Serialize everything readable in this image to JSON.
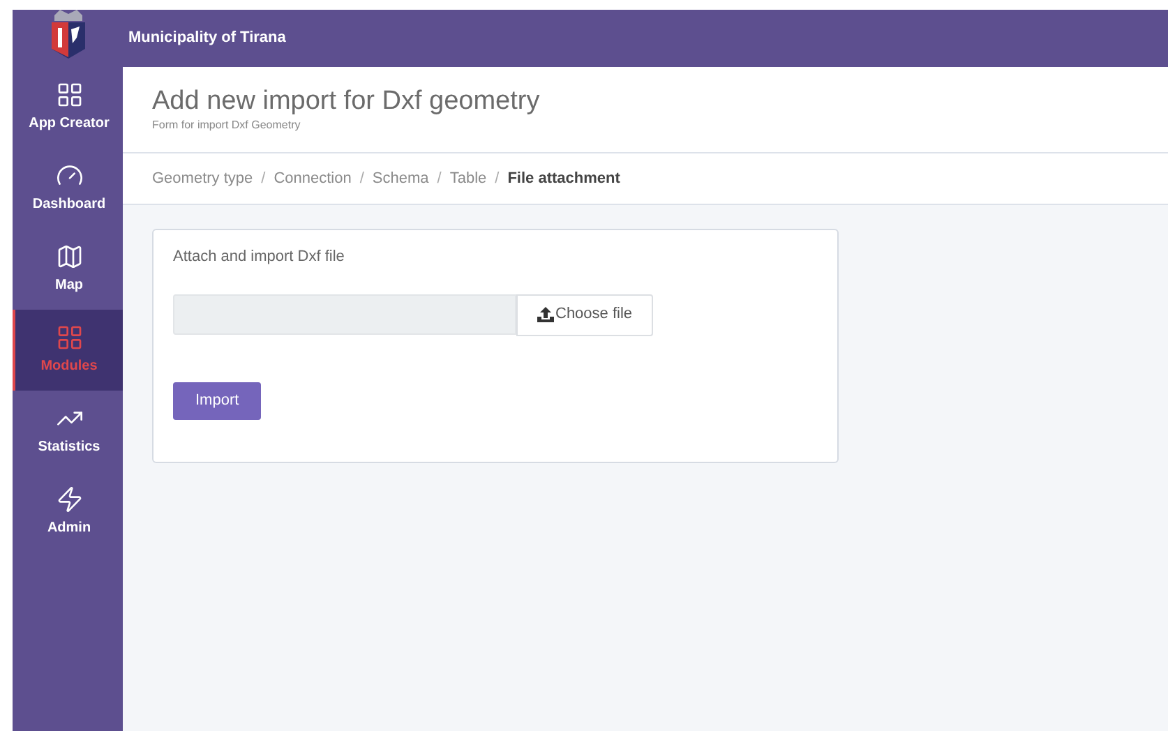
{
  "header": {
    "title": "Municipality of Tirana"
  },
  "sidebar": {
    "items": [
      {
        "label": "App Creator",
        "selected": false
      },
      {
        "label": "Dashboard",
        "selected": false
      },
      {
        "label": "Map",
        "selected": false
      },
      {
        "label": "Modules",
        "selected": true
      },
      {
        "label": "Statistics",
        "selected": false
      },
      {
        "label": "Admin",
        "selected": false
      }
    ]
  },
  "page": {
    "title": "Add new import for Dxf geometry",
    "subtitle": "Form for import Dxf Geometry"
  },
  "breadcrumb": [
    {
      "label": "Geometry type",
      "selected": false
    },
    {
      "label": "Connection",
      "selected": false
    },
    {
      "label": "Schema",
      "selected": false
    },
    {
      "label": "Table",
      "selected": false
    },
    {
      "label": "File attachment",
      "selected": true
    }
  ],
  "separator": "/",
  "form": {
    "title": "Attach and import Dxf file",
    "choose_button": "Choose file",
    "import_button": "Import"
  }
}
